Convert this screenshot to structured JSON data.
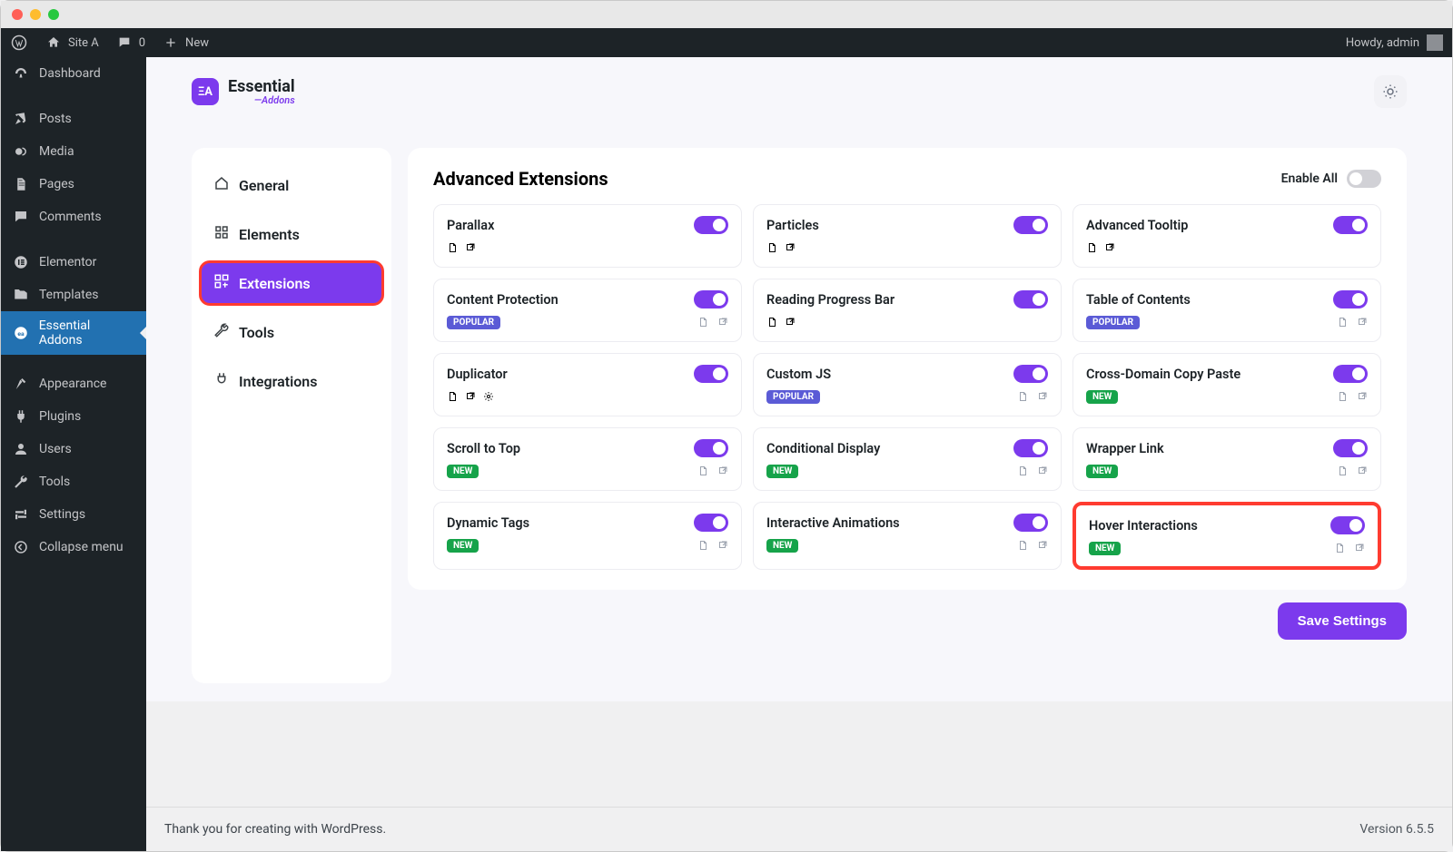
{
  "window": {
    "title": ""
  },
  "adminbar": {
    "site": "Site A",
    "comments": "0",
    "new": "New",
    "howdy": "Howdy, admin"
  },
  "wp_sidebar": {
    "items": [
      {
        "label": "Dashboard",
        "active": false
      },
      {
        "label": "Posts",
        "active": false
      },
      {
        "label": "Media",
        "active": false
      },
      {
        "label": "Pages",
        "active": false
      },
      {
        "label": "Comments",
        "active": false
      },
      {
        "label": "Elementor",
        "active": false
      },
      {
        "label": "Templates",
        "active": false
      },
      {
        "label": "Essential Addons",
        "active": true
      },
      {
        "label": "Appearance",
        "active": false
      },
      {
        "label": "Plugins",
        "active": false
      },
      {
        "label": "Users",
        "active": false
      },
      {
        "label": "Tools",
        "active": false
      },
      {
        "label": "Settings",
        "active": false
      },
      {
        "label": "Collapse menu",
        "active": false
      }
    ]
  },
  "ea": {
    "brand_top": "Essential",
    "brand_bottom": "—Addons",
    "tabs": [
      {
        "label": "General"
      },
      {
        "label": "Elements"
      },
      {
        "label": "Extensions",
        "active": true
      },
      {
        "label": "Tools"
      },
      {
        "label": "Integrations"
      }
    ],
    "panel_title": "Advanced Extensions",
    "enable_all_label": "Enable All",
    "save_label": "Save Settings"
  },
  "extensions": [
    {
      "name": "Parallax",
      "on": true,
      "badge": "",
      "row2_left": false
    },
    {
      "name": "Particles",
      "on": true,
      "badge": "",
      "row2_left": false
    },
    {
      "name": "Advanced Tooltip",
      "on": true,
      "badge": "",
      "row2_left": false
    },
    {
      "name": "Content Protection",
      "on": true,
      "badge": "POPULAR"
    },
    {
      "name": "Reading Progress Bar",
      "on": true,
      "badge": ""
    },
    {
      "name": "Table of Contents",
      "on": true,
      "badge": "POPULAR"
    },
    {
      "name": "Duplicator",
      "on": true,
      "badge": "",
      "extra_icon": true,
      "row2_left": false
    },
    {
      "name": "Custom JS",
      "on": true,
      "badge": "POPULAR"
    },
    {
      "name": "Cross-Domain Copy Paste",
      "on": true,
      "badge": "NEW"
    },
    {
      "name": "Scroll to Top",
      "on": true,
      "badge": "NEW"
    },
    {
      "name": "Conditional Display",
      "on": true,
      "badge": "NEW"
    },
    {
      "name": "Wrapper Link",
      "on": true,
      "badge": "NEW"
    },
    {
      "name": "Dynamic Tags",
      "on": true,
      "badge": "NEW"
    },
    {
      "name": "Interactive Animations",
      "on": true,
      "badge": "NEW"
    },
    {
      "name": "Hover Interactions",
      "on": true,
      "badge": "NEW",
      "highlighted": true
    }
  ],
  "footer": {
    "thanks": "Thank you for creating with WordPress.",
    "version": "Version 6.5.5"
  }
}
